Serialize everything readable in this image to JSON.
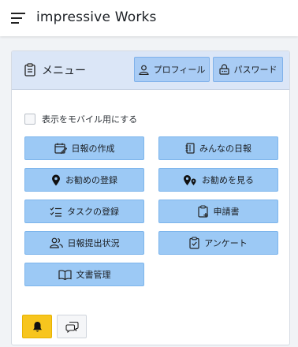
{
  "topbar": {
    "title": "impressive Works",
    "menu_icon": "hamburger-icon"
  },
  "menu_card": {
    "title": "メニュー",
    "title_icon": "clipboard-icon",
    "header_buttons": [
      {
        "label": "プロフィール",
        "icon": "person-icon"
      },
      {
        "label": "パスワード",
        "icon": "lock-icon"
      }
    ],
    "mobile_checkbox": {
      "label": "表示をモバイル用にする",
      "checked": false
    },
    "buttons": [
      {
        "label": "日報の作成",
        "icon": "calendar-edit-icon"
      },
      {
        "label": "みんなの日報",
        "icon": "notebook-icon"
      },
      {
        "label": "お勧めの登録",
        "icon": "map-pin-icon"
      },
      {
        "label": "お勧めを見る",
        "icon": "map-pins-icon"
      },
      {
        "label": "タスクの登録",
        "icon": "checklist-icon"
      },
      {
        "label": "申請書",
        "icon": "clipboard-plus-icon"
      },
      {
        "label": "日報提出状況",
        "icon": "people-icon"
      },
      {
        "label": "アンケート",
        "icon": "clipboard-check-icon"
      },
      {
        "label": "文書管理",
        "icon": "open-book-icon"
      }
    ],
    "footer_buttons": [
      {
        "icon": "bell-icon"
      },
      {
        "icon": "chat-icon"
      }
    ]
  },
  "colors": {
    "button_fill": "#9cc9f5",
    "header_fill": "#dbe6f7",
    "bell_button": "#f7c51e"
  }
}
